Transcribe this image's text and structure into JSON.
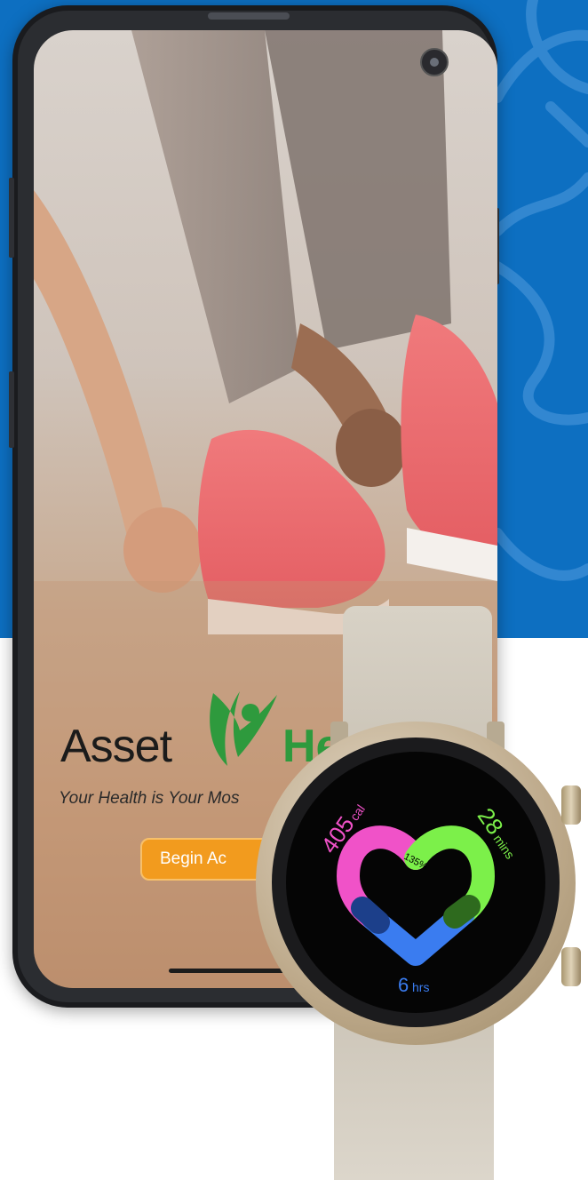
{
  "app": {
    "logo_word": "Asset",
    "logo_word2": "He",
    "tagline": "Your Health is Your Mos",
    "cta_label": "Begin Ac"
  },
  "watch": {
    "calories_value": "405",
    "calories_unit": "cal",
    "minutes_value": "28",
    "minutes_unit": "mins",
    "hours_value": "6",
    "hours_unit": "hrs",
    "percent": "135%",
    "colors": {
      "calories": "#f052c8",
      "minutes": "#7cf04a",
      "hours": "#3a7cf0",
      "background": "#050505"
    }
  },
  "colors": {
    "brand_blue": "#0d6fc1",
    "cta_orange": "#f29b1e",
    "logo_green": "#2e9a3d"
  }
}
